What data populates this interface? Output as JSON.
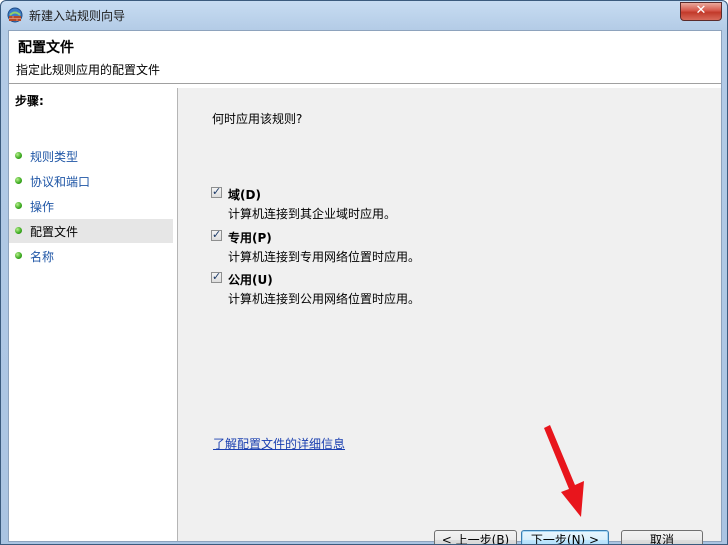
{
  "window": {
    "title": "新建入站规则向导",
    "close_symbol": "✕"
  },
  "header": {
    "title": "配置文件",
    "subtitle": "指定此规则应用的配置文件"
  },
  "steps": {
    "title": "步骤:",
    "items": [
      {
        "label": "规则类型"
      },
      {
        "label": "协议和端口"
      },
      {
        "label": "操作"
      },
      {
        "label": "配置文件",
        "active": true
      },
      {
        "label": "名称"
      }
    ]
  },
  "main": {
    "question": "何时应用该规则?",
    "options": [
      {
        "label": "域(D)",
        "description": "计算机连接到其企业域时应用。",
        "checked": true
      },
      {
        "label": "专用(P)",
        "description": "计算机连接到专用网络位置时应用。",
        "checked": true
      },
      {
        "label": "公用(U)",
        "description": "计算机连接到公用网络位置时应用。",
        "checked": true
      }
    ],
    "learn_more_link": "了解配置文件的详细信息"
  },
  "buttons": {
    "back": "< 上一步(B)",
    "next": "下一步(N) >",
    "cancel": "取消"
  },
  "annotation": {
    "color": "#e8151c"
  }
}
